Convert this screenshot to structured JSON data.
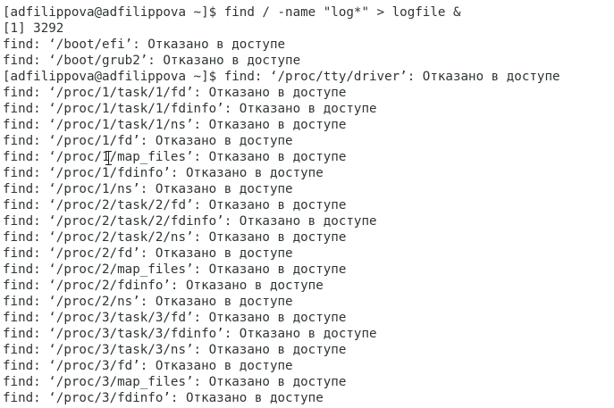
{
  "terminal": {
    "lines": [
      "[adfilippova@adfilippova ~]$ find / -name \"log*\" > logfile &",
      "[1] 3292",
      "find: ‘/boot/efi’: Отказано в доступе",
      "find: ‘/boot/grub2’: Отказано в доступе",
      "[adfilippova@adfilippova ~]$ find: ‘/proc/tty/driver’: Отказано в доступе",
      "find: ‘/proc/1/task/1/fd’: Отказано в доступе",
      "find: ‘/proc/1/task/1/fdinfo’: Отказано в доступе",
      "find: ‘/proc/1/task/1/ns’: Отказано в доступе",
      "find: ‘/proc/1/fd’: Отказано в доступе",
      "find: ‘/proc/1/map_files’: Отказано в доступе",
      "find: ‘/proc/1/fdinfo’: Отказано в доступе",
      "find: ‘/proc/1/ns’: Отказано в доступе",
      "find: ‘/proc/2/task/2/fd’: Отказано в доступе",
      "find: ‘/proc/2/task/2/fdinfo’: Отказано в доступе",
      "find: ‘/proc/2/task/2/ns’: Отказано в доступе",
      "find: ‘/proc/2/fd’: Отказано в доступе",
      "find: ‘/proc/2/map_files’: Отказано в доступе",
      "find: ‘/proc/2/fdinfo’: Отказано в доступе",
      "find: ‘/proc/2/ns’: Отказано в доступе",
      "find: ‘/proc/3/task/3/fd’: Отказано в доступе",
      "find: ‘/proc/3/task/3/fdinfo’: Отказано в доступе",
      "find: ‘/proc/3/task/3/ns’: Отказано в доступе",
      "find: ‘/proc/3/fd’: Отказано в доступе",
      "find: ‘/proc/3/map_files’: Отказано в доступе",
      "find: ‘/proc/3/fdinfo’: Отказано в доступе"
    ],
    "colors": {
      "background": "#ffffff",
      "foreground": "#2e3436"
    },
    "mouse_cursor_icon": "text-ibeam-cursor-icon"
  }
}
